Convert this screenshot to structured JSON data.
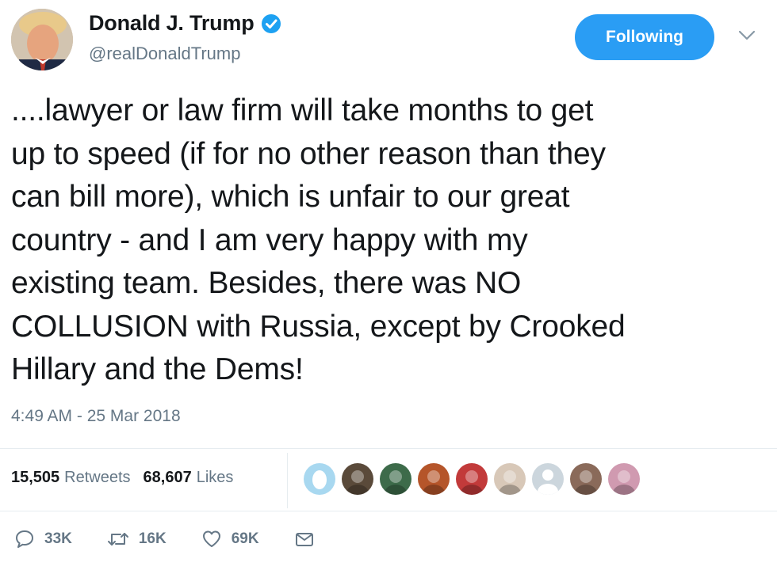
{
  "author": {
    "name": "Donald J. Trump",
    "handle": "@realDonaldTrump",
    "verified": true
  },
  "follow_button": {
    "label": "Following",
    "color": "#2a9df4"
  },
  "tweet": {
    "text": "....lawyer or law firm will take months to get\nup to speed (if for no other reason than they\ncan bill more), which is unfair to our great\ncountry - and I am very happy with my\nexisting team. Besides, there was NO\nCOLLUSION with Russia, except by Crooked\nHillary and the Dems!",
    "timestamp": "4:49 AM - 25 Mar 2018"
  },
  "stats": {
    "retweets_count": "15,505",
    "retweets_label": "Retweets",
    "likes_count": "68,607",
    "likes_label": "Likes"
  },
  "likers": [
    {
      "icon": "egg-avatar",
      "color": "#a8d8f0"
    },
    {
      "icon": "user-avatar",
      "color": "#5a4a3a"
    },
    {
      "icon": "user-avatar",
      "color": "#3d6b4a"
    },
    {
      "icon": "user-avatar",
      "color": "#b5552a"
    },
    {
      "icon": "user-avatar",
      "color": "#c23a3a"
    },
    {
      "icon": "user-avatar",
      "color": "#d8c8b8"
    },
    {
      "icon": "default-avatar",
      "color": "#ccd6dd"
    },
    {
      "icon": "user-avatar",
      "color": "#8a6a5a"
    },
    {
      "icon": "user-avatar",
      "color": "#d09ab0"
    }
  ],
  "actions": {
    "reply_count": "33K",
    "retweet_count": "16K",
    "like_count": "69K"
  }
}
